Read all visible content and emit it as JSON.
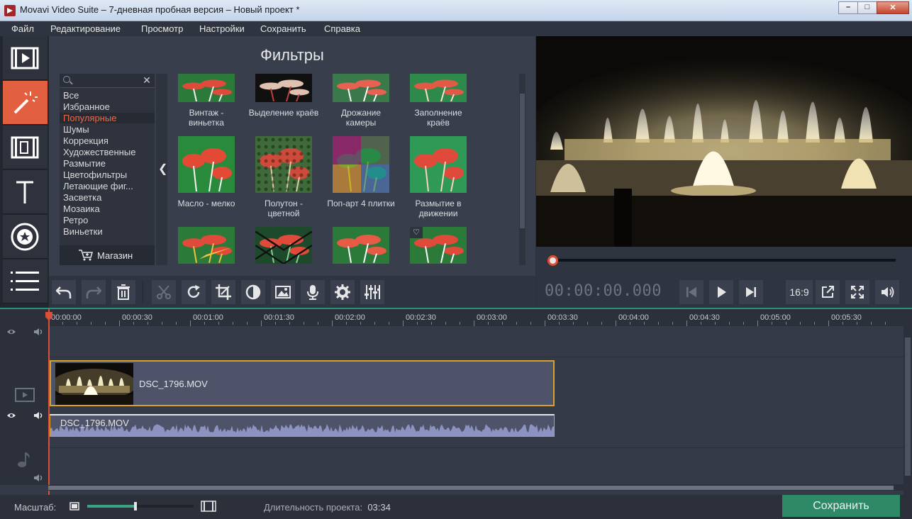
{
  "window": {
    "title": "Movavi Video Suite – 7-дневная пробная версия – Новый проект *"
  },
  "menu": [
    "Файл",
    "Редактирование",
    "Просмотр",
    "Настройки",
    "Сохранить",
    "Справка"
  ],
  "sidebar": {
    "tools": [
      "import-icon",
      "filters-wand-icon",
      "transitions-icon",
      "titles-icon",
      "stickers-star-icon",
      "menu-list-icon"
    ],
    "active": "filters-wand-icon"
  },
  "filters": {
    "title": "Фильтры",
    "search_placeholder": "",
    "categories": [
      "Все",
      "Избранное",
      "Популярные",
      "Шумы",
      "Коррекция",
      "Художественные",
      "Размытие",
      "Цветофильтры",
      "Летающие фиг...",
      "Засветка",
      "Мозаика",
      "Ретро",
      "Виньетки"
    ],
    "selected_category": "Популярные",
    "store_label": "Магазин",
    "items": [
      {
        "label": "Винтаж - виньетка"
      },
      {
        "label": "Выделение краёв"
      },
      {
        "label": "Дрожание камеры"
      },
      {
        "label": "Заполнение краёв"
      },
      {
        "label": "Масло - мелко"
      },
      {
        "label": "Полутон - цветной"
      },
      {
        "label": "Поп-арт 4 плитки"
      },
      {
        "label": "Размытие в движении"
      },
      {
        "label": ""
      },
      {
        "label": ""
      },
      {
        "label": ""
      },
      {
        "label": ""
      }
    ]
  },
  "player": {
    "timecode": "00:00:00.000",
    "aspect": "16:9",
    "progress": 0
  },
  "toolbar": {
    "buttons": [
      "undo-icon",
      "redo-icon",
      "delete-icon",
      "cut-icon",
      "rotate-icon",
      "crop-icon",
      "color-adjust-icon",
      "image-icon",
      "microphone-icon",
      "settings-icon",
      "equalizer-icon"
    ]
  },
  "timeline": {
    "ticks": [
      "00:00:00",
      "00:00:30",
      "00:01:00",
      "00:01:30",
      "00:02:00",
      "00:02:30",
      "00:03:00",
      "00:03:30",
      "00:04:00",
      "00:04:30",
      "00:05:00",
      "00:05:30"
    ],
    "video_clip": {
      "name": "DSC_1796.MOV"
    },
    "audio_clip": {
      "name": "DSC_1796.MOV"
    }
  },
  "bottom": {
    "scale_label": "Масштаб:",
    "zoom_level": 0.45,
    "duration_label": "Длительность проекта:",
    "duration_value": "03:34",
    "save_label": "Сохранить"
  },
  "colors": {
    "accent": "#e2603f",
    "save": "#2e8a66",
    "clip_border": "#d8a12c",
    "playhead": "#d9503a"
  }
}
